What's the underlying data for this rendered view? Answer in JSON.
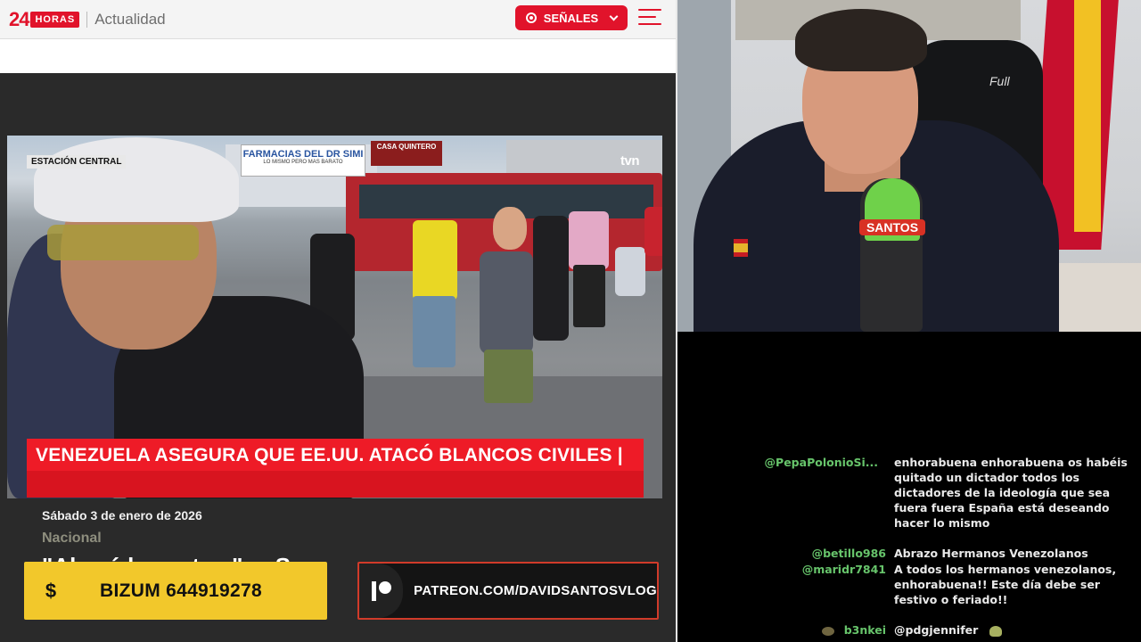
{
  "site": {
    "logo_number": "24",
    "logo_word": "HORAS",
    "section": "Actualidad",
    "signals_label": "SEÑALES"
  },
  "video": {
    "location_tag": "ESTACIÓN CENTRAL",
    "channel": "tvn",
    "headline": "VENEZUELA ASEGURA QUE EE.UU. ATACÓ BLANCOS CIVILES |",
    "sign_pharmacy": "FARMACIAS DEL DR SIMI",
    "sign_pharmacy_sub": "LO MISMO PERO MAS BARATO",
    "sign_shop": "CASA QUINTERO"
  },
  "article": {
    "date": "Sábado 3 de enero de 2026",
    "category": "Nacional",
    "title_partial": "\"Al  ... á  l  ... est ... \" ... Sa"
  },
  "overlays": {
    "bizum_icon": "$",
    "bizum_text": "BIZUM 644919278",
    "patreon_text": "PATREON.COM/DAVIDSANTOSVLOG"
  },
  "webcam": {
    "mic_brand": "SANTOS",
    "chair_brand": "Full"
  },
  "chat": {
    "messages": [
      {
        "user": "@PepaPolonioSi...",
        "text": "enhorabuena enhorabuena os habéis quitado un dictador todos los dictadores de la ideología que sea fuera fuera España está deseando hacer lo mismo"
      },
      {
        "user": "@betillo986",
        "text": "Abrazo Hermanos Venezolanos"
      },
      {
        "user": "@maridr7841",
        "text": "A todos los hermanos venezolanos, enhorabuena!! Este día debe ser festivo o feriado!!"
      },
      {
        "user": "b3nkei",
        "text": "@pdgjennifer"
      }
    ],
    "colors": {
      "username": "#67c46b",
      "text": "#e9e9e9"
    }
  },
  "colors": {
    "brand_red": "#e1132b",
    "bizum_yellow": "#f2c82b",
    "chat_bg": "#000000"
  }
}
